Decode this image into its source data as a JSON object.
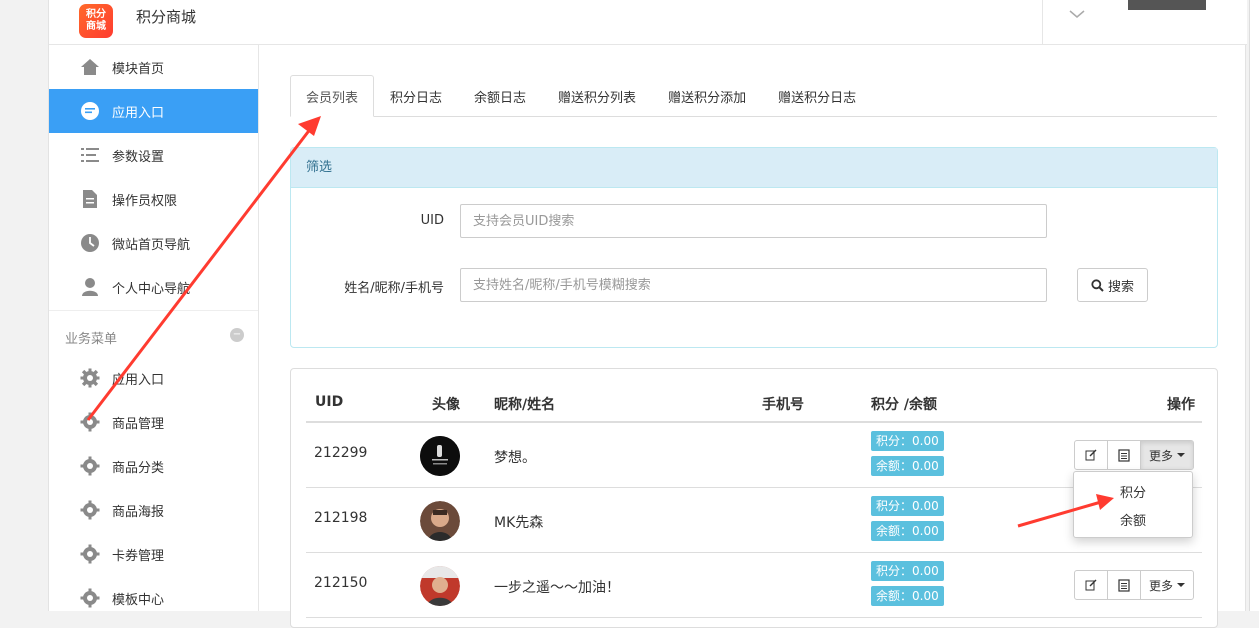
{
  "header": {
    "logo_text": "积分商城",
    "app_title": "积分商城"
  },
  "sidebar": {
    "items": [
      {
        "label": "模块首页",
        "icon": "home-icon"
      },
      {
        "label": "应用入口",
        "icon": "chat-icon",
        "active": true
      },
      {
        "label": "参数设置",
        "icon": "list-icon"
      },
      {
        "label": "操作员权限",
        "icon": "document-icon"
      },
      {
        "label": "微站首页导航",
        "icon": "clock-icon"
      },
      {
        "label": "个人中心导航",
        "icon": "user-icon"
      }
    ],
    "section_label": "业务菜单",
    "biz_items": [
      {
        "label": "应用入口",
        "icon": "gear-icon"
      },
      {
        "label": "商品管理",
        "icon": "gear-icon"
      },
      {
        "label": "商品分类",
        "icon": "gear-icon"
      },
      {
        "label": "商品海报",
        "icon": "gear-icon"
      },
      {
        "label": "卡券管理",
        "icon": "gear-icon"
      },
      {
        "label": "模板中心",
        "icon": "gear-icon"
      }
    ]
  },
  "tabs": [
    "会员列表",
    "积分日志",
    "余额日志",
    "赠送积分列表",
    "赠送积分添加",
    "赠送积分日志"
  ],
  "filter": {
    "title": "筛选",
    "uid_label": "UID",
    "uid_placeholder": "支持会员UID搜索",
    "name_label": "姓名/昵称/手机号",
    "name_placeholder": "支持姓名/昵称/手机号模糊搜索",
    "search_button": "搜索"
  },
  "table": {
    "headers": {
      "uid": "UID",
      "avatar": "头像",
      "name": "昵称/姓名",
      "phone": "手机号",
      "points_balance": "积分 /余额",
      "actions": "操作"
    },
    "rows": [
      {
        "uid": "212299",
        "name": "梦想。",
        "phone": "",
        "points": "积分：0.00",
        "balance": "余额：0.00"
      },
      {
        "uid": "212198",
        "name": "MK先森",
        "phone": "",
        "points": "积分：0.00",
        "balance": "余额：0.00"
      },
      {
        "uid": "212150",
        "name": "一步之遥～～加油！",
        "phone": "",
        "points": "积分：0.00",
        "balance": "余额：0.00"
      }
    ],
    "more_label": "更多"
  },
  "dropdown": {
    "items": [
      "积分",
      "余额"
    ]
  },
  "colors": {
    "accent": "#3a9ff5",
    "badge": "#5bc0de",
    "filter_header": "#d9edf7",
    "annotation_arrow": "#ff3b30"
  }
}
